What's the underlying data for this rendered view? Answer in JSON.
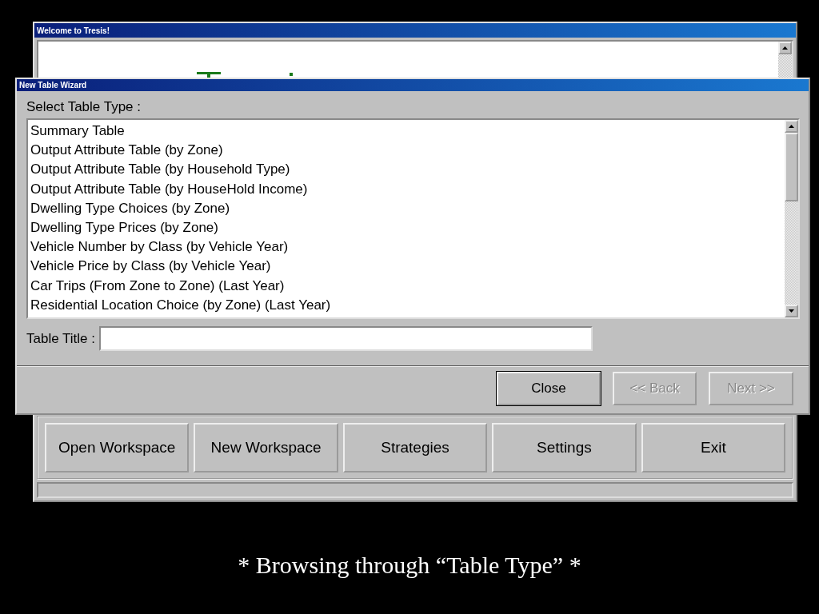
{
  "main_window": {
    "title": "Welcome to Tresis!",
    "toolbar": [
      "Open Workspace",
      "New Workspace",
      "Strategies",
      "Settings",
      "Exit"
    ]
  },
  "dialog": {
    "title": "New Table Wizard",
    "list_label": "Select Table Type :",
    "table_types": [
      {
        "label": "Summary Table",
        "selected": false
      },
      {
        "label": "Output Attribute Table (by Zone)",
        "selected": false
      },
      {
        "label": "Output Attribute Table (by Household Type)",
        "selected": false
      },
      {
        "label": "Output Attribute Table (by HouseHold Income)",
        "selected": false
      },
      {
        "label": "Dwelling Type Choices (by Zone)",
        "selected": false
      },
      {
        "label": "Dwelling Type Prices (by Zone)",
        "selected": false
      },
      {
        "label": "Vehicle Number by Class (by Vehicle Year)",
        "selected": false
      },
      {
        "label": "Vehicle Price by Class (by Vehicle Year)",
        "selected": false
      },
      {
        "label": "Car Trips (From Zone to Zone) (Last Year)",
        "selected": false
      },
      {
        "label": "Residential Location Choice (by Zone) (Last Year)",
        "selected": false
      }
    ],
    "title_label": "Table Title :",
    "buttons": [
      {
        "label": "Close",
        "disabled": false
      },
      {
        "label": "<< Back",
        "disabled": true
      },
      {
        "label": "Next >>",
        "disabled": true
      }
    ]
  },
  "caption": "* Browsing through “Table Type” *"
}
